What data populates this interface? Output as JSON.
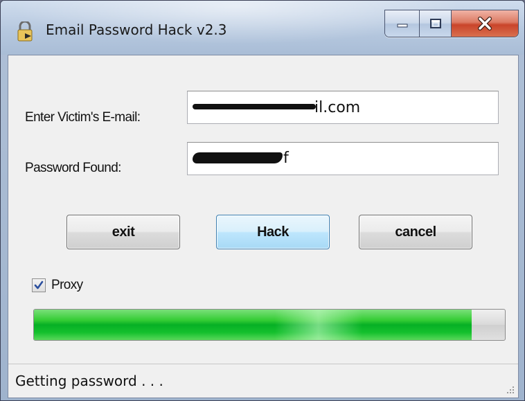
{
  "window": {
    "title": "Email Password Hack v2.3",
    "icons": {
      "app": "wrench-app-icon",
      "minimize": "minimize-icon",
      "maximize": "maximize-icon",
      "close": "close-icon"
    }
  },
  "form": {
    "email_label": "Enter Victim's E-mail:",
    "email_value": "il.com",
    "password_label": "Password Found:",
    "password_value": "f"
  },
  "buttons": {
    "exit": "exit",
    "hack": "Hack",
    "cancel": "cancel"
  },
  "proxy": {
    "label": "Proxy",
    "checked": true
  },
  "progress": {
    "value": 0.93
  },
  "status": {
    "text": "Getting password . . ."
  },
  "colors": {
    "progress_green": "#06b025",
    "close_red": "#c9442a",
    "focus_blue": "#3c7fb1"
  }
}
